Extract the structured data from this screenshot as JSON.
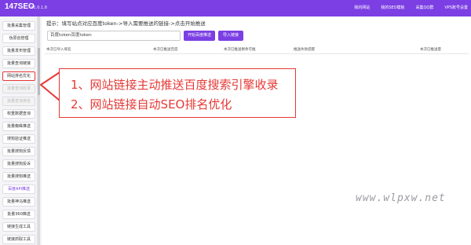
{
  "topbar": {
    "logo": "147SEO",
    "version": "V1.0.1.8",
    "nav": [
      "我的网站",
      "我的SEO模板",
      "采集QQ群",
      "VPS账号设置"
    ]
  },
  "sidebar": {
    "items": [
      {
        "label": "批量采集管理",
        "state": "normal"
      },
      {
        "label": "伪原创管理",
        "state": "normal"
      },
      {
        "label": "批量发布管理",
        "state": "normal"
      },
      {
        "label": "批量查询链接",
        "state": "normal"
      },
      {
        "label": "网站排名优化",
        "state": "active"
      },
      {
        "label": "批量查询收录",
        "state": "disabled"
      },
      {
        "label": "批量查询排名",
        "state": "disabled"
      },
      {
        "label": "权重数据查询",
        "state": "normal"
      },
      {
        "label": "批量蜘蛛推送",
        "state": "normal"
      },
      {
        "label": "搜狗验证推送",
        "state": "normal"
      },
      {
        "label": "批量搜狗反馈",
        "state": "normal"
      },
      {
        "label": "批量搜狗投诉",
        "state": "normal"
      },
      {
        "label": "批量搜狗推送",
        "state": "normal"
      },
      {
        "label": "百度API推送",
        "state": "purple"
      },
      {
        "label": "批量神马推送",
        "state": "normal"
      },
      {
        "label": "批量360推送",
        "state": "normal"
      },
      {
        "label": "链接生成工具",
        "state": "normal"
      },
      {
        "label": "链接抓取工具",
        "state": "normal"
      }
    ]
  },
  "main": {
    "hint": "提示：填写站点对应百度token->导入需要推送的链接->点击开始推送",
    "token_input": "百度token百度token",
    "buttons": {
      "start": "开始百度推送",
      "import": "导入链接"
    },
    "columns": [
      "本次已导入域名",
      "本次已推送百度",
      "本次已推送剩余可推",
      "推送失败提醒",
      "本次已推送量"
    ]
  },
  "annotation": {
    "line1": "1、网站链接主动推送百度搜索引擎收录",
    "line2": "2、网站链接自动SEO排名优化"
  },
  "watermark": "www.wlpxw.net",
  "colors": {
    "accent": "#7b3fe4",
    "annotation": "#e53935"
  }
}
